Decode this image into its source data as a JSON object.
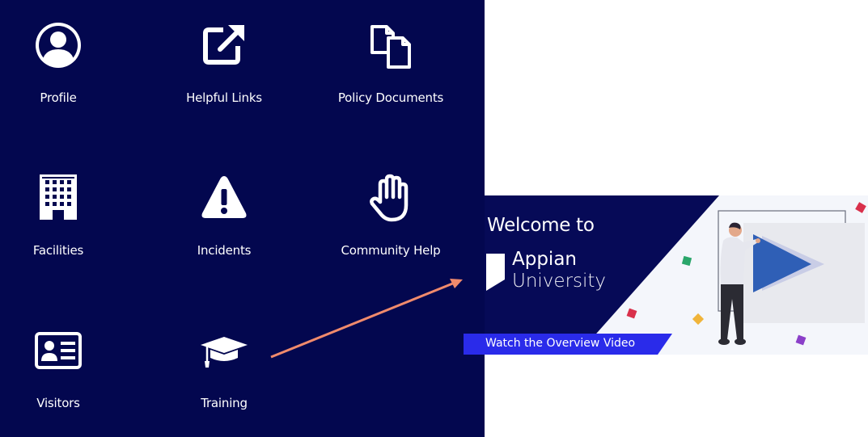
{
  "tiles": [
    {
      "label": "Profile",
      "icon": "user-circle-icon"
    },
    {
      "label": "Helpful Links",
      "icon": "external-link-icon"
    },
    {
      "label": "Policy Documents",
      "icon": "documents-icon"
    },
    {
      "label": "Facilities",
      "icon": "building-icon"
    },
    {
      "label": "Incidents",
      "icon": "warning-icon"
    },
    {
      "label": "Community Help",
      "icon": "hand-icon"
    },
    {
      "label": "Visitors",
      "icon": "id-card-icon"
    },
    {
      "label": "Training",
      "icon": "graduation-cap-icon"
    }
  ],
  "banner": {
    "welcome": "Welcome to",
    "brand_line1": "Appian",
    "brand_line2": "University",
    "button_label": "Watch the Overview Video"
  },
  "colors": {
    "panel_bg": "#03074f",
    "banner_bg": "#060a57",
    "button_bg": "#2a2bea",
    "arrow": "#f08a6c",
    "play": "#2f5fb6"
  }
}
